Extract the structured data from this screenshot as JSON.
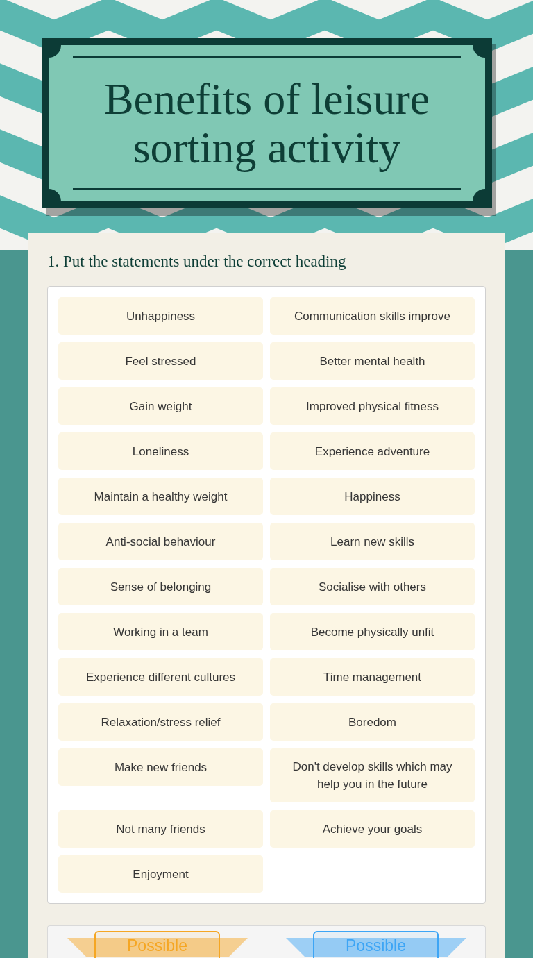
{
  "title": "Benefits of leisure sorting activity",
  "question": "1. Put the statements under the correct heading",
  "statements": [
    "Unhappiness",
    "Communication skills improve",
    "Feel stressed",
    "Better mental health",
    "Gain weight",
    "Improved physical fitness",
    "Loneliness",
    "Experience adventure",
    "Maintain a healthy weight",
    "Happiness",
    "Anti-social behaviour",
    "Learn new skills",
    "Sense of belonging",
    "Socialise with others",
    "Working in a team",
    "Become physically unfit",
    "Experience different cultures",
    "Time management",
    "Relaxation/stress relief",
    "Boredom",
    "Make new friends",
    "Don't develop skills which may help you in the future",
    "Not many friends",
    "Achieve your goals",
    "Enjoyment"
  ],
  "categories": [
    {
      "label": "Possible",
      "color": "#f5a623"
    },
    {
      "label": "Possible",
      "color": "#3da5f5"
    }
  ]
}
